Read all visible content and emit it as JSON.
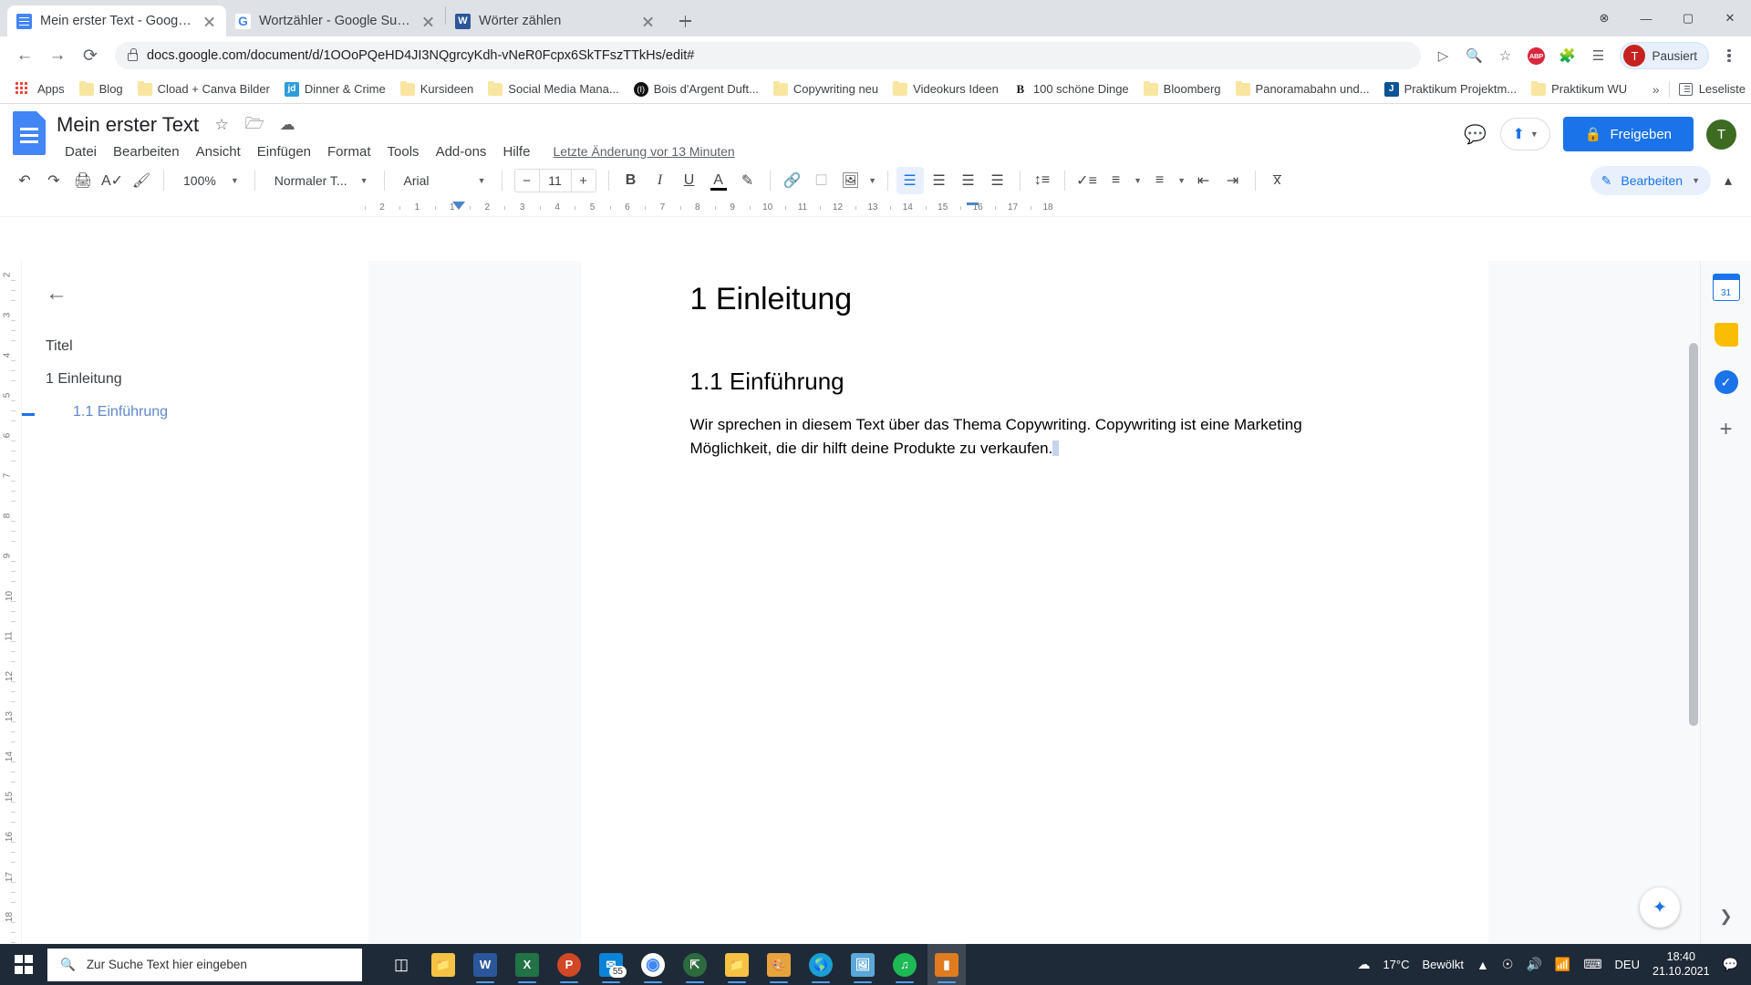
{
  "browser": {
    "tabs": [
      {
        "title": "Mein erster Text - Google Docs",
        "icon": "google-docs-favicon",
        "active": true
      },
      {
        "title": "Wortzähler - Google Suche",
        "icon": "google-favicon",
        "active": false
      },
      {
        "title": "Wörter zählen",
        "icon": "word-favicon",
        "active": false
      }
    ],
    "newtab_label": "+",
    "window_controls": {
      "minimize": "—",
      "maximize": "▢",
      "close": "✕",
      "extra": "⊗"
    },
    "url": "docs.google.com/document/d/1OOoPQeHD4JI3NQgrcyKdh-vNeR0Fcpx6SkTFszTTkHs/edit#",
    "nav": {
      "back": "←",
      "forward": "→",
      "reload": "⟳"
    },
    "omni_icons": [
      "cast-icon",
      "zoom-icon",
      "bookmark-star-icon",
      "adblock-plus-icon",
      "extensions-puzzle-icon",
      "media-list-icon"
    ],
    "profile": {
      "initial": "T",
      "label": "Pausiert"
    },
    "bookmarks": [
      {
        "label": "Apps",
        "icon": "apps-grid-icon"
      },
      {
        "label": "Blog",
        "icon": "folder-icon"
      },
      {
        "label": "Cload + Canva Bilder",
        "icon": "folder-icon"
      },
      {
        "label": "Dinner & Crime",
        "icon": "jd-icon"
      },
      {
        "label": "Kursideen",
        "icon": "folder-icon"
      },
      {
        "label": "Social Media Mana...",
        "icon": "folder-icon"
      },
      {
        "label": "Bois d'Argent Duft...",
        "icon": "dior-icon"
      },
      {
        "label": "Copywriting neu",
        "icon": "folder-icon"
      },
      {
        "label": "Videokurs Ideen",
        "icon": "folder-icon"
      },
      {
        "label": "100 schöne Dinge",
        "icon": "blogger-b-icon"
      },
      {
        "label": "Bloomberg",
        "icon": "folder-icon"
      },
      {
        "label": "Panoramabahn und...",
        "icon": "folder-icon"
      },
      {
        "label": "Praktikum Projektm...",
        "icon": "jira-j-icon"
      },
      {
        "label": "Praktikum WU",
        "icon": "folder-icon"
      }
    ],
    "overflow_label": "»",
    "reading_list_label": "Leseliste"
  },
  "docs": {
    "doc_title": "Mein erster Text",
    "title_icons": [
      "star-icon",
      "move-to-folder-icon",
      "cloud-saved-icon"
    ],
    "menus": [
      "Datei",
      "Bearbeiten",
      "Ansicht",
      "Einfügen",
      "Format",
      "Tools",
      "Add-ons",
      "Hilfe"
    ],
    "last_edit": "Letzte Änderung vor 13 Minuten",
    "comment_history_icon": "comment-history-icon",
    "present_icon": "present-icon",
    "share_label": "Freigeben",
    "share_lock_icon": "lock-icon",
    "account_initial": "T",
    "toolbar": {
      "undo": "↶",
      "redo": "↷",
      "print": "print-icon",
      "spellcheck": "spellcheck-icon",
      "paint_format": "paint-format-icon",
      "zoom_value": "100%",
      "style_value": "Normaler T...",
      "font_value": "Arial",
      "font_size": "11",
      "size_minus": "−",
      "size_plus": "+",
      "bold": "B",
      "italic": "I",
      "underline": "U",
      "text_color": "A",
      "highlight": "highlight-icon",
      "link": "link-icon",
      "comment": "add-comment-icon",
      "image": "insert-image-icon",
      "align_left": "align-left-icon",
      "align_center": "align-center-icon",
      "align_right": "align-right-icon",
      "align_justify": "align-justify-icon",
      "line_spacing": "line-spacing-icon",
      "checklist": "checklist-icon",
      "bullet_list": "bullet-list-icon",
      "numbered_list": "numbered-list-icon",
      "indent_less": "indent-decrease-icon",
      "indent_more": "indent-increase-icon",
      "clear_format": "clear-formatting-icon",
      "edit_mode_label": "Bearbeiten",
      "collapse_icon": "chevron-up-icon"
    },
    "ruler": {
      "numbers": [
        "2",
        "1",
        "1",
        "2",
        "3",
        "4",
        "5",
        "6",
        "7",
        "8",
        "9",
        "10",
        "11",
        "12",
        "13",
        "14",
        "15",
        "16",
        "17",
        "18"
      ],
      "vertical_numbers": [
        "2",
        "3",
        "4",
        "5",
        "6",
        "7",
        "8",
        "9",
        "10",
        "11",
        "12",
        "13",
        "14",
        "15",
        "16",
        "17",
        "18"
      ]
    },
    "outline": {
      "back_icon": "back-arrow-icon",
      "items": [
        {
          "label": "Titel",
          "level": 1,
          "active": false
        },
        {
          "label": "1 Einleitung",
          "level": 1,
          "active": false
        },
        {
          "label": "1.1 Einführung",
          "level": 2,
          "active": true
        }
      ]
    },
    "document": {
      "heading1": "1 Einleitung",
      "heading2": "1.1 Einführung",
      "paragraph": "Wir sprechen in diesem Text über das Thema Copywriting. Copywriting ist eine Marketing Möglichkeit, die dir hilft deine Produkte zu verkaufen."
    },
    "side_rail": {
      "items": [
        "google-calendar-icon",
        "google-keep-icon",
        "google-tasks-icon",
        "add-ons-plus-icon"
      ],
      "explore_icon": "explore-icon",
      "expand_icon": "chevron-right-icon"
    }
  },
  "taskbar": {
    "start_icon": "windows-start-icon",
    "search_placeholder": "Zur Suche Text hier eingeben",
    "search_icon": "search-icon",
    "apps": [
      {
        "name": "task-view-icon",
        "label": ""
      },
      {
        "name": "file-explorer-icon",
        "label": ""
      },
      {
        "name": "word-icon",
        "label": "W"
      },
      {
        "name": "excel-icon",
        "label": "X"
      },
      {
        "name": "powerpoint-icon",
        "label": "P"
      },
      {
        "name": "mail-icon",
        "label": "",
        "badge": "55"
      },
      {
        "name": "chrome-icon",
        "label": ""
      },
      {
        "name": "edge-legacy-icon",
        "label": ""
      },
      {
        "name": "folder-icon",
        "label": ""
      },
      {
        "name": "paint-icon",
        "label": ""
      },
      {
        "name": "edge-icon",
        "label": ""
      },
      {
        "name": "photos-icon",
        "label": ""
      },
      {
        "name": "spotify-icon",
        "label": ""
      },
      {
        "name": "app-orange-icon",
        "label": ""
      }
    ],
    "weather": {
      "temp": "17°C",
      "condition": "Bewölkt",
      "icon": "cloud-icon"
    },
    "tray_icons": [
      "show-hidden-icons-chevron",
      "meet-camera-icon",
      "volume-icon",
      "wifi-icon",
      "keyboard-icon"
    ],
    "language": "DEU",
    "time": "18:40",
    "date": "21.10.2021",
    "notification_icon": "notification-icon"
  },
  "colors": {
    "chrome_tabstrip": "#dee1e6",
    "docs_blue": "#1a73e8",
    "share_button": "#1a73e8",
    "taskbar": "#1f2a38",
    "outline_active": "#5f87c8"
  }
}
